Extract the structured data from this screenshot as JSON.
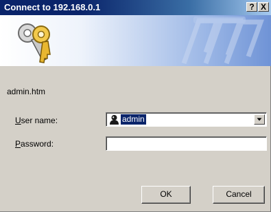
{
  "window": {
    "title": "Connect to 192.168.0.1",
    "help_button": "?",
    "close_button": "X"
  },
  "banner": {
    "icon": "keys-icon",
    "watermark": "keys-watermark"
  },
  "form": {
    "site_label": "admin.htm",
    "username_label_accel": "U",
    "username_label_rest": "ser name:",
    "username_value": "admin",
    "username_icon": "user-icon",
    "password_label_accel": "P",
    "password_label_rest": "assword:",
    "password_value": ""
  },
  "buttons": {
    "ok": "OK",
    "cancel": "Cancel"
  },
  "colors": {
    "titlebar": "#0a246a",
    "selection": "#0a246a",
    "face": "#d4d0c8"
  }
}
